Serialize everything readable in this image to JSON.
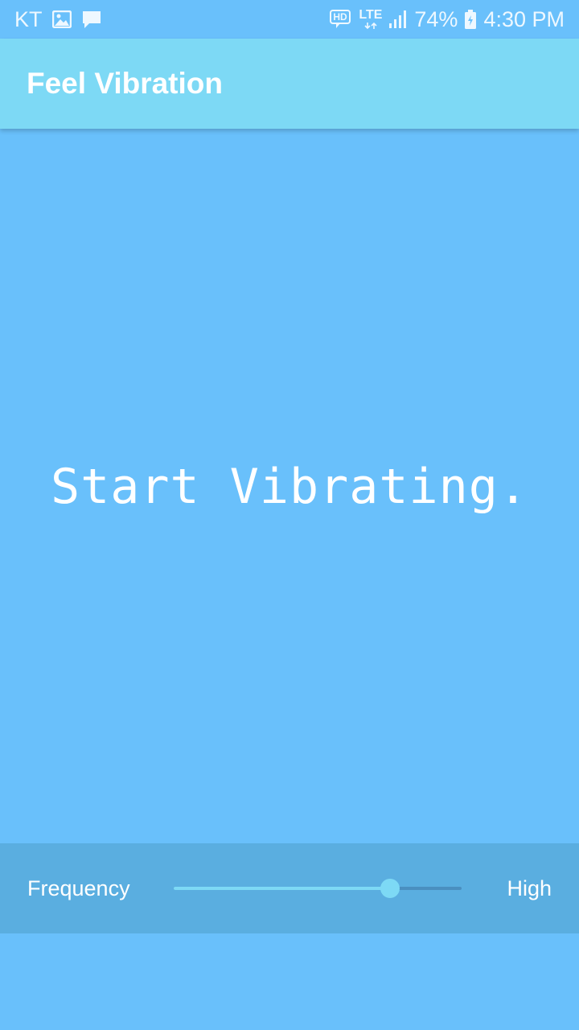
{
  "status_bar": {
    "carrier": "KT",
    "left_icons": [
      "image-icon",
      "message-icon"
    ],
    "right_icons": [
      "hd-voice-icon",
      "lte-icon",
      "signal-icon",
      "battery-charging-icon"
    ],
    "hd": "HD",
    "network": "LTE",
    "battery": "74%",
    "time": "4:30 PM"
  },
  "app_bar": {
    "title": "Feel Vibration",
    "background": "#7dd9f5"
  },
  "main": {
    "message": "Start Vibrating.",
    "background": "#69c0fb"
  },
  "controls": {
    "frequency_label": "Frequency",
    "level_label": "High",
    "slider_value": 0.75,
    "panel_color": "#5aaee0"
  }
}
